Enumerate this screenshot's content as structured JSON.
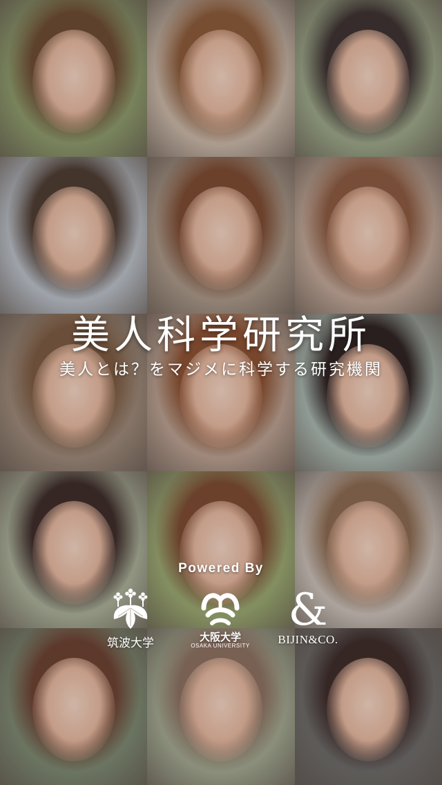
{
  "app": {
    "title": "美人科学研究所",
    "tagline": "美人とは？をマジメに科学する研究機関"
  },
  "powered_by": {
    "label": "Powered By",
    "partners": [
      {
        "name": "筑波大学",
        "icon": "paulownia-crest-icon"
      },
      {
        "name": "大阪大学",
        "subname": "OSAKA UNIVERSITY",
        "icon": "osaka-university-icon"
      },
      {
        "name": "BIJIN&CO.",
        "icon": "ampersand-icon"
      }
    ]
  },
  "background": {
    "description_tiles": [
      {
        "bg": "#8a9a6a",
        "hair": "#6a4a30"
      },
      {
        "bg": "#c8b8a8",
        "hair": "#8a5a38"
      },
      {
        "bg": "#9aa888",
        "hair": "#3a3030"
      },
      {
        "bg": "#b8c0c8",
        "hair": "#4a3a30"
      },
      {
        "bg": "#a89888",
        "hair": "#7a4a30"
      },
      {
        "bg": "#c0a898",
        "hair": "#8a5a40"
      },
      {
        "bg": "#9a8878",
        "hair": "#7a5a40"
      },
      {
        "bg": "#b8a090",
        "hair": "#8a5030"
      },
      {
        "bg": "#a8b8b0",
        "hair": "#2a2020"
      },
      {
        "bg": "#a8b098",
        "hair": "#3a2a28"
      },
      {
        "bg": "#98a870",
        "hair": "#7a4a30"
      },
      {
        "bg": "#c8c0b8",
        "hair": "#8a6a50"
      },
      {
        "bg": "#7a8870",
        "hair": "#6a4030"
      },
      {
        "bg": "#a0a890",
        "hair": "#8a7060"
      },
      {
        "bg": "#6a6a68",
        "hair": "#3a2a28"
      }
    ]
  }
}
